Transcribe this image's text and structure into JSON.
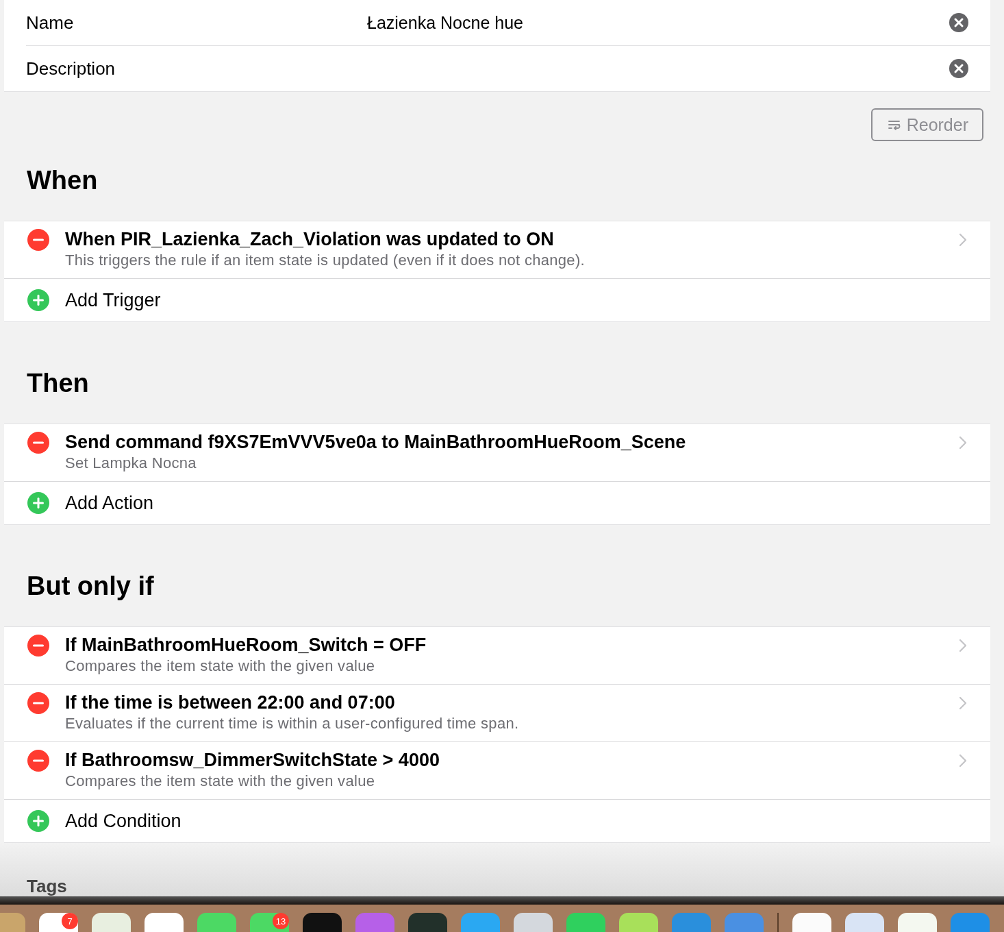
{
  "fields": [
    {
      "label": "Name",
      "value": "Łazienka Nocne hue"
    },
    {
      "label": "Description"
    }
  ],
  "reorder_button": "Reorder",
  "sections": [
    {
      "title": "When",
      "items": [
        {
          "title": "When PIR_Lazienka_Zach_Violation was updated to ON",
          "subtitle": "This triggers the rule if an item state is updated (even if it does not change)."
        }
      ],
      "add_label": "Add Trigger"
    },
    {
      "title": "Then",
      "items": [
        {
          "title": "Send command f9XS7EmVVV5ve0a to MainBathroomHueRoom_Scene",
          "subtitle": "Set Lampka Nocna"
        }
      ],
      "add_label": "Add Action"
    },
    {
      "title": "But only if",
      "items": [
        {
          "title": "If MainBathroomHueRoom_Switch = OFF",
          "subtitle": "Compares the item state with the given value"
        },
        {
          "title": "If the time is between 22:00 and 07:00",
          "subtitle": "Evaluates if the current time is within a user-configured time span."
        },
        {
          "title": "If Bathroomsw_DimmerSwitchState > 4000",
          "subtitle": "Compares the item state with the given value"
        }
      ],
      "add_label": "Add Condition"
    }
  ],
  "tags_heading": "Tags",
  "dock": [
    {
      "color": "#c9a56b"
    },
    {
      "color": "#ffffff",
      "badge": "7"
    },
    {
      "color": "#e8efe0"
    },
    {
      "color": "#ffffff"
    },
    {
      "color": "#4cd964"
    },
    {
      "color": "#4cd964",
      "badge": "13"
    },
    {
      "color": "#111111"
    },
    {
      "color": "#b660e8"
    },
    {
      "color": "#22302a"
    },
    {
      "color": "#2aa8f2"
    },
    {
      "color": "#d4d8dd"
    },
    {
      "color": "#2fd05e"
    },
    {
      "color": "#a8e05a"
    },
    {
      "color": "#2a8fdc"
    },
    {
      "color": "#4a90e2"
    },
    {
      "kind": "separator"
    },
    {
      "color": "#fbfbfb"
    },
    {
      "color": "#d9e4f5"
    },
    {
      "color": "#f4f8f0"
    },
    {
      "color": "#1e8fe6"
    }
  ]
}
